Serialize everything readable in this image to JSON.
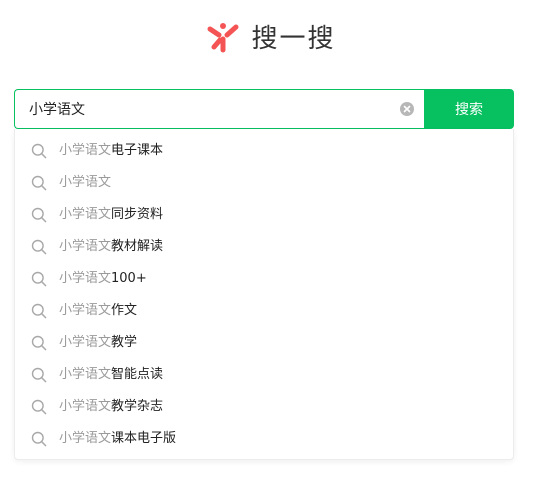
{
  "header": {
    "title": "搜一搜",
    "logo_icon": "sou-yi-sou-logo-icon",
    "logo_color": "#f45454"
  },
  "search": {
    "value": "小学语文",
    "clear_icon": "clear-circle-icon",
    "button_label": "搜索",
    "accent_color": "#07c160"
  },
  "suggestions": {
    "icon": "search-icon",
    "items": [
      {
        "prefix": "小学语文",
        "rest": "电子课本"
      },
      {
        "prefix": "小学语文",
        "rest": ""
      },
      {
        "prefix": "小学语文",
        "rest": "同步资料"
      },
      {
        "prefix": "小学语文",
        "rest": "教材解读"
      },
      {
        "prefix": "小学语文",
        "rest": "100+"
      },
      {
        "prefix": "小学语文",
        "rest": "作文"
      },
      {
        "prefix": "小学语文",
        "rest": "教学"
      },
      {
        "prefix": "小学语文",
        "rest": "智能点读"
      },
      {
        "prefix": "小学语文",
        "rest": "教学杂志"
      },
      {
        "prefix": "小学语文",
        "rest": "课本电子版"
      }
    ]
  }
}
